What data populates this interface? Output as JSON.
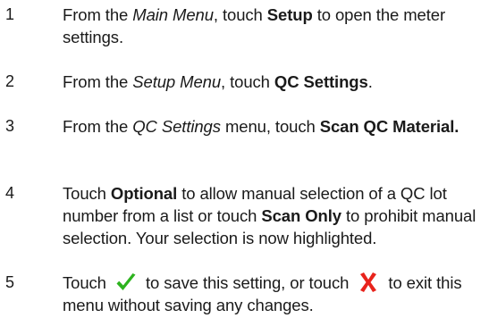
{
  "steps": [
    {
      "number": "1",
      "parts": [
        "From the ",
        "Main Menu",
        ", touch ",
        "Setup",
        " to open the meter settings."
      ]
    },
    {
      "number": "2",
      "parts": [
        "From the ",
        "Setup Menu",
        ", touch ",
        "QC Settings",
        "."
      ]
    },
    {
      "number": "3",
      "parts": [
        "From the ",
        "QC Settings",
        " menu, touch ",
        "Scan QC Material."
      ]
    },
    {
      "number": "4",
      "parts": [
        "Touch ",
        "Optional",
        " to allow manual selection of a QC lot number from a list or touch ",
        "Scan Only",
        " to prohibit manual selection. Your selection is now highlighted."
      ]
    },
    {
      "number": "5",
      "parts": [
        "Touch ",
        " to save this setting, or touch ",
        " to exit this menu without saving any changes."
      ]
    }
  ],
  "icons": {
    "confirm": "checkmark-icon",
    "cancel": "x-icon",
    "confirm_color": "#2db31e",
    "cancel_color": "#e8231c"
  }
}
